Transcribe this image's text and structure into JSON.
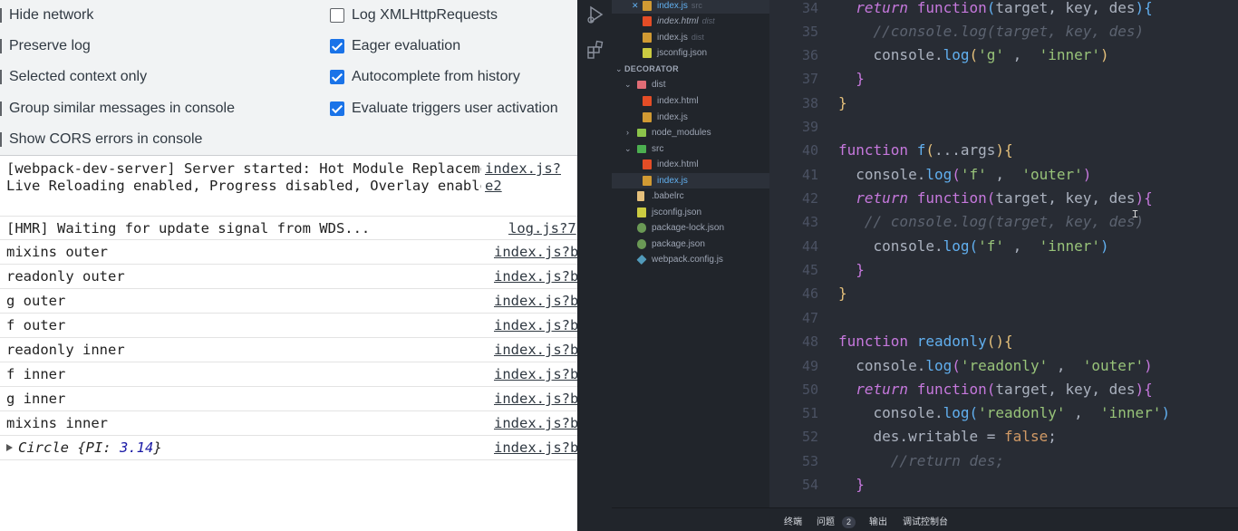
{
  "devtools": {
    "settings": {
      "left": [
        {
          "label": "Hide network",
          "checked": false
        },
        {
          "label": "Preserve log",
          "checked": false
        },
        {
          "label": "Selected context only",
          "checked": false
        },
        {
          "label": "Group similar messages in console",
          "checked": false
        },
        {
          "label": "Show CORS errors in console",
          "checked": false
        }
      ],
      "right": [
        {
          "label": "Log XMLHttpRequests",
          "checked": false
        },
        {
          "label": "Eager evaluation",
          "checked": true
        },
        {
          "label": "Autocomplete from history",
          "checked": true
        },
        {
          "label": "Evaluate triggers user activation",
          "checked": true
        }
      ]
    },
    "messages": [
      {
        "text": "[webpack-dev-server] Server started: Hot Module Replacement enabled, Live Reloading enabled, Progress disabled, Overlay enabled.",
        "source": "index.js?e2"
      },
      {
        "text": "[HMR] Waiting for update signal from WDS...",
        "source": "log.js?7"
      },
      {
        "text": "mixins outer",
        "source": "index.js?b"
      },
      {
        "text": "readonly outer",
        "source": "index.js?b"
      },
      {
        "text": "g outer",
        "source": "index.js?b"
      },
      {
        "text": "f outer",
        "source": "index.js?b"
      },
      {
        "text": "readonly inner",
        "source": "index.js?b"
      },
      {
        "text": "f inner",
        "source": "index.js?b"
      },
      {
        "text": "g inner",
        "source": "index.js?b"
      },
      {
        "text": "mixins inner",
        "source": "index.js?b"
      }
    ],
    "object_message": {
      "class": "Circle",
      "key": "PI",
      "value": "3.14",
      "source": "index.js?b"
    }
  },
  "vscode": {
    "explorer": {
      "open_editors": [
        {
          "name": "index.js",
          "hint": "src",
          "icon": "js"
        },
        {
          "name": "index.html",
          "hint": "dist",
          "icon": "html"
        },
        {
          "name": "index.js",
          "hint": "dist",
          "icon": "js"
        },
        {
          "name": "jsconfig.json",
          "hint": "",
          "icon": "json"
        }
      ],
      "section_title": "DECORATOR",
      "tree": [
        {
          "name": "dist",
          "type": "folder"
        },
        {
          "name": "index.html",
          "type": "html"
        },
        {
          "name": "index.js",
          "type": "js"
        },
        {
          "name": "node_modules",
          "type": "folder"
        },
        {
          "name": "src",
          "type": "folder"
        },
        {
          "name": "index.html",
          "type": "html"
        },
        {
          "name": "index.js",
          "type": "js"
        },
        {
          "name": ".babelrc",
          "type": "babel"
        },
        {
          "name": "jsconfig.json",
          "type": "json"
        },
        {
          "name": "package-lock.json",
          "type": "npm"
        },
        {
          "name": "package.json",
          "type": "npm"
        },
        {
          "name": "webpack.config.js",
          "type": "webpack"
        }
      ]
    },
    "editor": {
      "line_numbers": [
        "34",
        "35",
        "36",
        "37",
        "38",
        "39",
        "40",
        "41",
        "42",
        "43",
        "44",
        "45",
        "46",
        "47",
        "48",
        "49",
        "50",
        "51",
        "52",
        "53",
        "54"
      ],
      "code_lines": [
        "  return function(target, key, des){",
        "    //console.log(target, key, des)",
        "    console.log('g' ,  'inner')",
        "  }",
        "}",
        "",
        "function f(...args){",
        "  console.log('f' ,  'outer')",
        "  return function(target, key, des){",
        "   // console.log(target, key, des)",
        "    console.log('f' ,  'inner')",
        "  }",
        "}",
        "",
        "function readonly(){",
        "  console.log('readonly' ,  'outer')",
        "  return function(target, key, des){",
        "    console.log('readonly' ,  'inner')",
        "    des.writable = false;",
        "      //return des;",
        "  }"
      ]
    },
    "panel_tabs": {
      "terminal": "终端",
      "problems": "问题",
      "problems_count": "2",
      "output": "输出",
      "debug_console": "调试控制台"
    },
    "colors": {
      "editor_bg": "#282c34",
      "sidebar_bg": "#21252b",
      "keyword": "#c678dd",
      "function": "#61afef",
      "string": "#98c379",
      "comment": "#5c6370"
    }
  }
}
